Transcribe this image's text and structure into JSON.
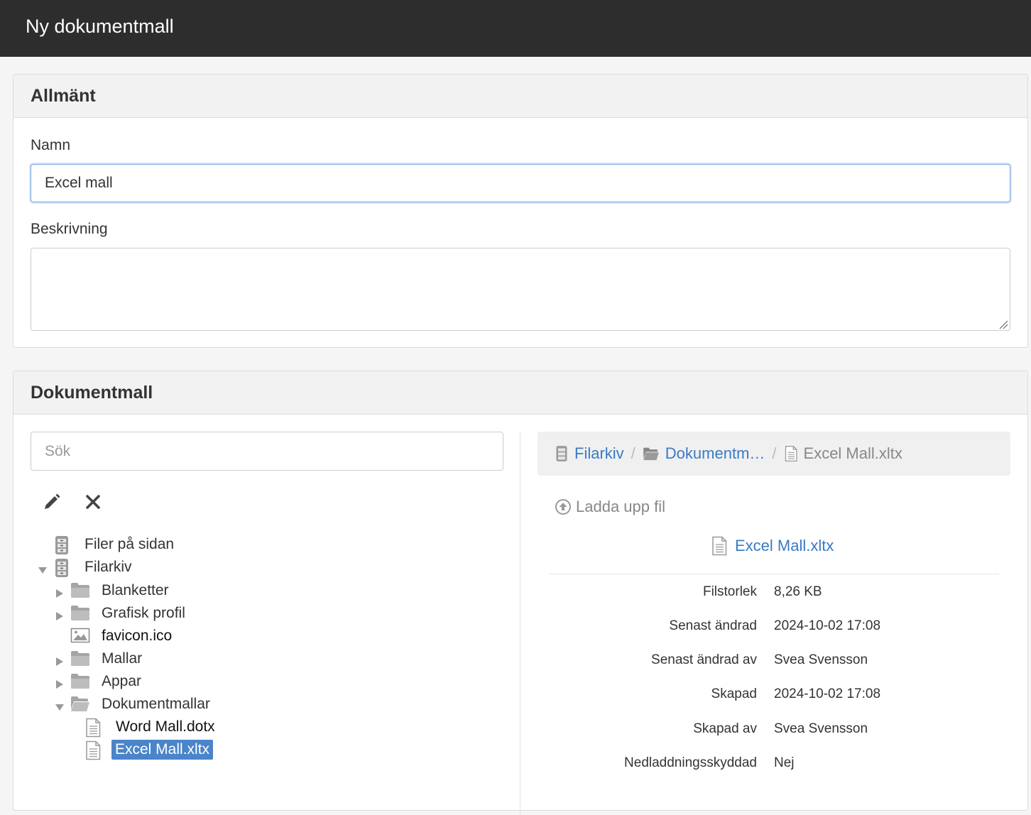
{
  "header": {
    "title": "Ny dokumentmall"
  },
  "general": {
    "title": "Allmänt",
    "name_label": "Namn",
    "name_value": "Excel mall",
    "description_label": "Beskrivning",
    "description_value": ""
  },
  "template": {
    "title": "Dokumentmall",
    "search_placeholder": "Sök",
    "tools": {
      "edit_icon": "pencil-icon",
      "delete_icon": "close-icon"
    },
    "tree": [
      {
        "label": "Filer på sidan",
        "icon": "file-cabinet-icon",
        "expanded": false
      },
      {
        "label": "Filarkiv",
        "icon": "file-cabinet-icon",
        "expanded": true
      },
      {
        "label": "Blanketter",
        "icon": "folder-icon",
        "expanded": false
      },
      {
        "label": "Grafisk profil",
        "icon": "folder-icon",
        "expanded": false
      },
      {
        "label": "favicon.ico",
        "icon": "image-icon"
      },
      {
        "label": "Mallar",
        "icon": "folder-icon",
        "expanded": false
      },
      {
        "label": "Appar",
        "icon": "folder-icon",
        "expanded": false
      },
      {
        "label": "Dokumentmallar",
        "icon": "folder-open-icon",
        "expanded": true
      },
      {
        "label": "Word Mall.dotx",
        "icon": "document-icon"
      },
      {
        "label": "Excel Mall.xltx",
        "icon": "document-icon",
        "selected": true
      }
    ],
    "breadcrumb": [
      {
        "label": "Filarkiv",
        "icon": "file-cabinet-icon"
      },
      {
        "label": "Dokumentm…",
        "icon": "folder-open-icon"
      },
      {
        "label": "Excel Mall.xltx",
        "icon": "document-icon"
      }
    ],
    "breadcrumb_separator": "/",
    "upload_label": "Ladda upp fil",
    "file_name": "Excel Mall.xltx",
    "meta": [
      {
        "key": "Filstorlek",
        "value": "8,26 KB"
      },
      {
        "key": "Senast ändrad",
        "value": "2024-10-02 17:08"
      },
      {
        "key": "Senast ändrad av",
        "value": "Svea Svensson"
      },
      {
        "key": "Skapad",
        "value": "2024-10-02 17:08"
      },
      {
        "key": "Skapad av",
        "value": "Svea Svensson"
      },
      {
        "key": "Nedladdningsskyddad",
        "value": "Nej"
      }
    ]
  },
  "colors": {
    "topbar": "#2d2d2d",
    "link": "#3b7ac4",
    "selection": "#4a84c9"
  }
}
